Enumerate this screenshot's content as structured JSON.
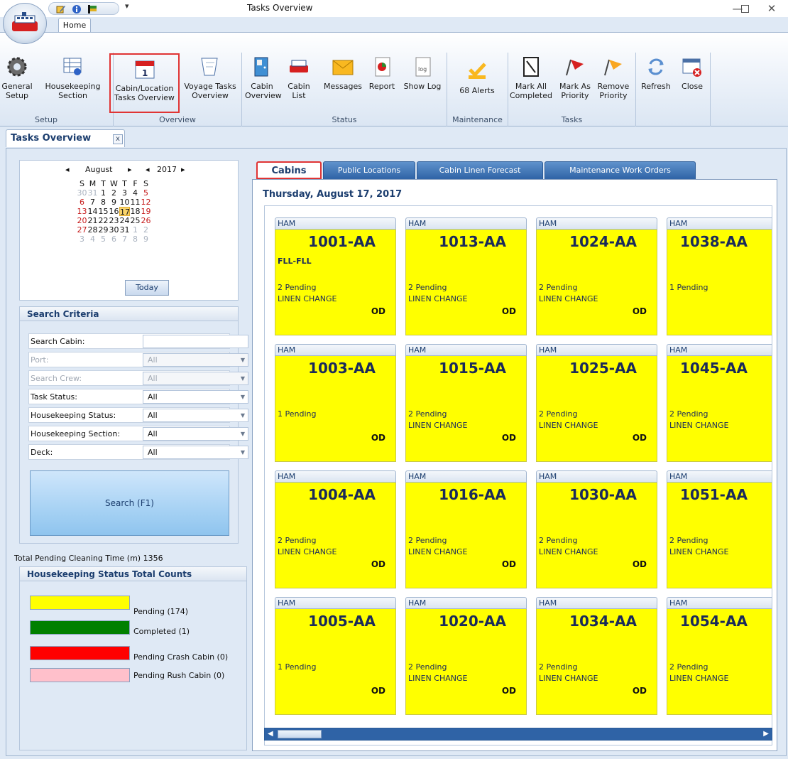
{
  "window": {
    "title": "Tasks Overview"
  },
  "ribbon": {
    "tab_home": "Home",
    "groups": {
      "setup": "Setup",
      "overview": "Overview",
      "status": "Status",
      "maintenance": "Maintenance",
      "tasks": "Tasks"
    },
    "buttons": {
      "general_setup_1": "General",
      "general_setup_2": "Setup",
      "hk_section_1": "Housekeeping",
      "hk_section_2": "Section",
      "cabin_location_1": "Cabin/Location",
      "cabin_location_2": "Tasks Overview",
      "voyage_tasks_1": "Voyage Tasks",
      "voyage_tasks_2": "Overview",
      "cabin_overview_1": "Cabin",
      "cabin_overview_2": "Overview",
      "cabin_list_1": "Cabin",
      "cabin_list_2": "List",
      "messages": "Messages",
      "report": "Report",
      "show_log": "Show Log",
      "alerts": "68 Alerts",
      "mark_all_1": "Mark All",
      "mark_all_2": "Completed",
      "mark_priority_1": "Mark As",
      "mark_priority_2": "Priority",
      "remove_priority_1": "Remove",
      "remove_priority_2": "Priority",
      "refresh": "Refresh",
      "close": "Close"
    }
  },
  "doc_tab": {
    "label": "Tasks Overview",
    "close": "x"
  },
  "calendar": {
    "month": "August",
    "year": "2017",
    "weekdays": [
      "S",
      "M",
      "T",
      "W",
      "T",
      "F",
      "S"
    ],
    "weeks": [
      [
        "30",
        "31",
        "1",
        "2",
        "3",
        "4",
        "5"
      ],
      [
        "6",
        "7",
        "8",
        "9",
        "10",
        "11",
        "12"
      ],
      [
        "13",
        "14",
        "15",
        "16",
        "17",
        "18",
        "19"
      ],
      [
        "20",
        "21",
        "22",
        "23",
        "24",
        "25",
        "26"
      ],
      [
        "27",
        "28",
        "29",
        "30",
        "31",
        "1",
        "2"
      ],
      [
        "3",
        "4",
        "5",
        "6",
        "7",
        "8",
        "9"
      ]
    ],
    "today_button": "Today"
  },
  "search": {
    "title": "Search Criteria",
    "fields": [
      {
        "label": "Search Cabin:",
        "value": ""
      },
      {
        "label": "Port:",
        "value": "All"
      },
      {
        "label": "Search Crew:",
        "value": "All"
      },
      {
        "label": "Task Status:",
        "value": "All"
      },
      {
        "label": "Housekeeping Status:",
        "value": "All"
      },
      {
        "label": "Housekeeping Section:",
        "value": "All"
      },
      {
        "label": "Deck:",
        "value": "All"
      }
    ],
    "button": "Search (F1)"
  },
  "total_pending": "Total Pending Cleaning Time (m) 1356",
  "status_counts": {
    "title": "Housekeeping Status Total Counts",
    "items": [
      {
        "label": "Pending (174)",
        "color": "#ffff00"
      },
      {
        "label": "Completed (1)",
        "color": "#008000"
      },
      {
        "label": "Pending Crash Cabin (0)",
        "color": "#ff0000"
      },
      {
        "label": "Pending Rush Cabin (0)",
        "color": "#ffc0cb"
      }
    ]
  },
  "right_tabs": [
    "Cabins",
    "Public Locations",
    "Cabin Linen Forecast",
    "Maintenance Work Orders"
  ],
  "date_title": "Thursday, August 17, 2017",
  "cabins": [
    {
      "header": "HAM",
      "number": "1001-AA",
      "sub": "FLL-FLL",
      "pending": "2 Pending",
      "task": "LINEN CHANGE",
      "flag": "OD"
    },
    {
      "header": "HAM",
      "number": "1013-AA",
      "sub": "",
      "pending": "2 Pending",
      "task": "LINEN CHANGE",
      "flag": "OD"
    },
    {
      "header": "HAM",
      "number": "1024-AA",
      "sub": "",
      "pending": "2 Pending",
      "task": "LINEN CHANGE",
      "flag": "OD"
    },
    {
      "header": "HAM",
      "number": "1038-AA",
      "sub": "",
      "pending": "1 Pending",
      "task": "",
      "flag": ""
    },
    {
      "header": "HAM",
      "number": "1003-AA",
      "sub": "",
      "pending": "1 Pending",
      "task": "",
      "flag": "OD"
    },
    {
      "header": "HAM",
      "number": "1015-AA",
      "sub": "",
      "pending": "2 Pending",
      "task": "LINEN CHANGE",
      "flag": "OD"
    },
    {
      "header": "HAM",
      "number": "1025-AA",
      "sub": "",
      "pending": "2 Pending",
      "task": "LINEN CHANGE",
      "flag": "OD"
    },
    {
      "header": "HAM",
      "number": "1045-AA",
      "sub": "",
      "pending": "2 Pending",
      "task": "LINEN CHANGE",
      "flag": ""
    },
    {
      "header": "HAM",
      "number": "1004-AA",
      "sub": "",
      "pending": "2 Pending",
      "task": "LINEN CHANGE",
      "flag": "OD"
    },
    {
      "header": "HAM",
      "number": "1016-AA",
      "sub": "",
      "pending": "2 Pending",
      "task": "LINEN CHANGE",
      "flag": "OD"
    },
    {
      "header": "HAM",
      "number": "1030-AA",
      "sub": "",
      "pending": "2 Pending",
      "task": "LINEN CHANGE",
      "flag": "OD"
    },
    {
      "header": "HAM",
      "number": "1051-AA",
      "sub": "",
      "pending": "2 Pending",
      "task": "LINEN CHANGE",
      "flag": ""
    },
    {
      "header": "HAM",
      "number": "1005-AA",
      "sub": "",
      "pending": "1 Pending",
      "task": "",
      "flag": "OD"
    },
    {
      "header": "HAM",
      "number": "1020-AA",
      "sub": "",
      "pending": "2 Pending",
      "task": "LINEN CHANGE",
      "flag": "OD"
    },
    {
      "header": "HAM",
      "number": "1034-AA",
      "sub": "",
      "pending": "2 Pending",
      "task": "LINEN CHANGE",
      "flag": "OD"
    },
    {
      "header": "HAM",
      "number": "1054-AA",
      "sub": "",
      "pending": "2 Pending",
      "task": "LINEN CHANGE",
      "flag": ""
    }
  ]
}
